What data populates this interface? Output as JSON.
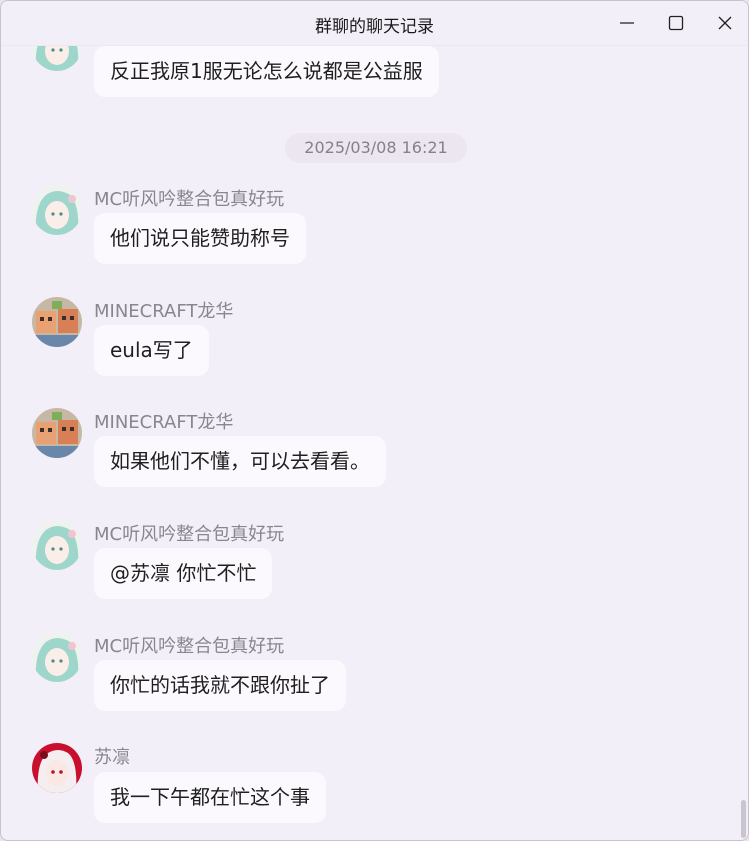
{
  "window": {
    "title": "群聊的聊天记录",
    "minimize_icon": "minimize-icon",
    "maximize_icon": "maximize-icon",
    "close_icon": "close-icon"
  },
  "chat": {
    "timestamp": "2025/03/08 16:21",
    "messages": [
      {
        "sender": "",
        "avatar": "anime-girl-green-hair-avatar",
        "text": "反正我原1服无论怎么说都是公益服"
      },
      {
        "sender": "MC听风吟整合包真好玩",
        "avatar": "anime-girl-green-hair-avatar",
        "text": "他们说只能赞助称号"
      },
      {
        "sender": "MINECRAFT龙华",
        "avatar": "minecraft-characters-avatar",
        "text": "eula写了"
      },
      {
        "sender": "MINECRAFT龙华",
        "avatar": "minecraft-characters-avatar",
        "text": "如果他们不懂，可以去看看。"
      },
      {
        "sender": "MC听风吟整合包真好玩",
        "avatar": "anime-girl-green-hair-avatar",
        "text": "@苏凛 你忙不忙"
      },
      {
        "sender": "MC听风吟整合包真好玩",
        "avatar": "anime-girl-green-hair-avatar",
        "text": "你忙的话我就不跟你扯了"
      },
      {
        "sender": "苏凛",
        "avatar": "anime-girl-red-avatar",
        "text": "我一下午都在忙这个事"
      }
    ]
  },
  "colors": {
    "background": "#f3eff8",
    "bubble": "#fbf9fd",
    "sender_text": "#8a8590",
    "timestamp_bg": "#ebe6ef"
  }
}
